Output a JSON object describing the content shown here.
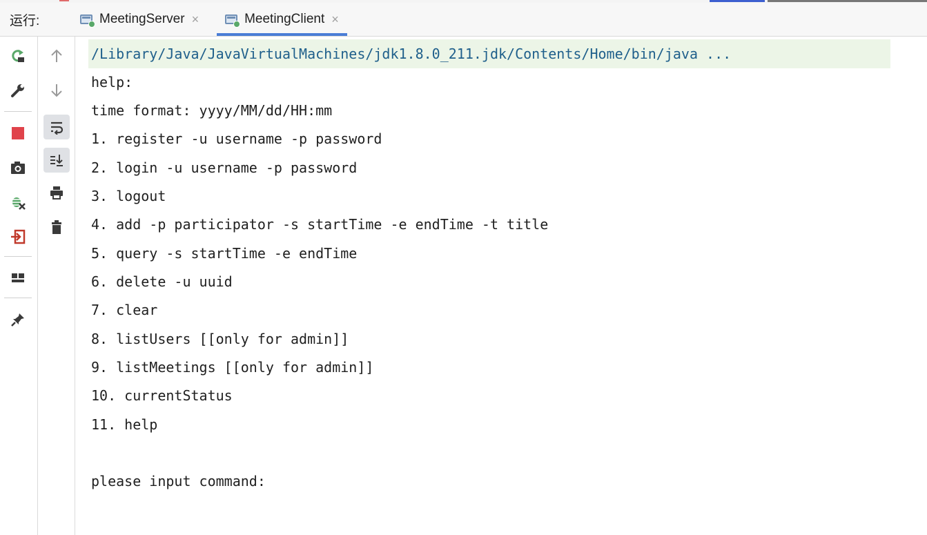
{
  "run_panel": {
    "label": "运行:",
    "tabs": [
      {
        "title": "MeetingServer",
        "active": false
      },
      {
        "title": "MeetingClient",
        "active": true
      }
    ],
    "close_glyph": "×"
  },
  "toolbar": {
    "icons": [
      "rerun-icon",
      "wrench-icon",
      "up-arrow-icon",
      "down-arrow-icon",
      "stop-icon",
      "soft-wrap-icon",
      "camera-icon",
      "scroll-to-end-icon",
      "debug-icon",
      "print-icon",
      "exit-icon",
      "trash-icon",
      "layout-icon",
      "pin-icon"
    ]
  },
  "console": {
    "command": "/Library/Java/JavaVirtualMachines/jdk1.8.0_211.jdk/Contents/Home/bin/java ...",
    "lines": [
      "help:",
      "time format: yyyy/MM/dd/HH:mm",
      "1. register -u username -p password",
      "2. login -u username -p password",
      "3. logout",
      "4. add -p participator -s startTime -e endTime -t title",
      "5. query -s startTime -e endTime",
      "6. delete -u uuid",
      "7. clear",
      "8. listUsers [[only for admin]]",
      "9. listMeetings [[only for admin]]",
      "10. currentStatus",
      "11. help",
      "",
      "please input command:"
    ]
  },
  "colors": {
    "accent": "#4a7dd6",
    "command_bg": "#ecf5e7",
    "stop": "#e0434b",
    "rerun": "#59a869"
  }
}
